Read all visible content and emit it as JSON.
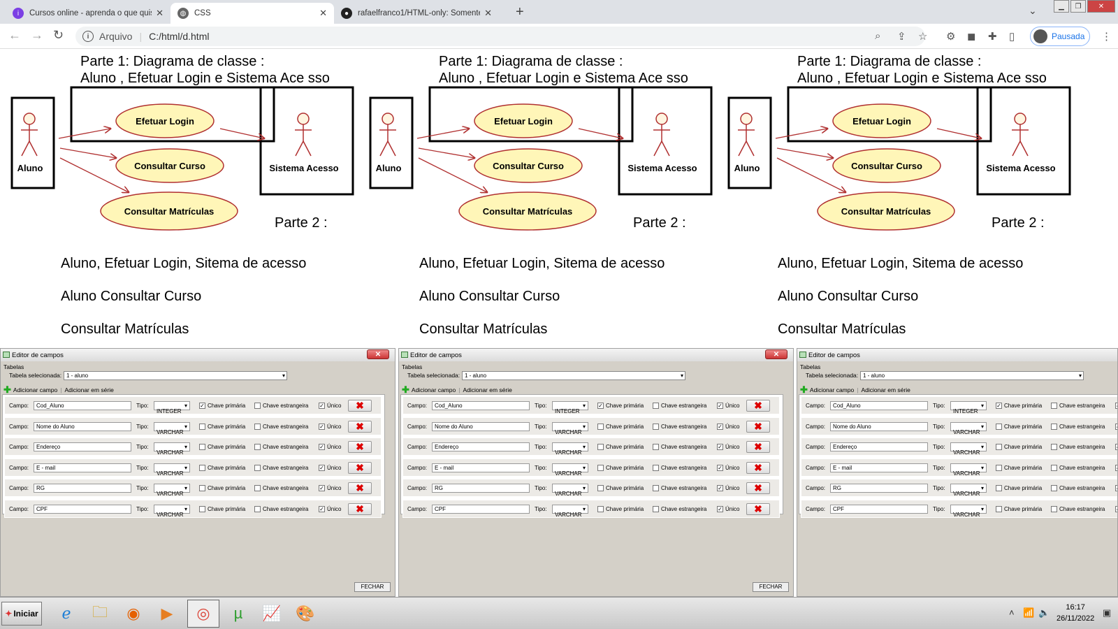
{
  "browser": {
    "tabs": [
      {
        "title": "Cursos online - aprenda o que quiser",
        "icon": "alura-icon",
        "active": false
      },
      {
        "title": "CSS",
        "icon": "globe-icon",
        "active": true
      },
      {
        "title": "rafaelfranco1/HTML-only: Somente",
        "icon": "github-icon",
        "active": false
      }
    ],
    "new_tab": "+",
    "address_prefix": "Arquivo",
    "url": "C:/html/d.html",
    "profile_label": "Pausada"
  },
  "page": {
    "heading_line1": "Parte 1: Diagrama de classe :",
    "heading_line2": "Aluno , Efetuar Login e Sistema Ace sso",
    "actor_left": "Aluno",
    "actor_right": "Sistema Acesso",
    "usecases": [
      "Efetuar Login",
      "Consultar Curso",
      "Consultar Matrículas"
    ],
    "parte2": "Parte 2 :",
    "lines": [
      "Aluno, Efetuar Login, Sitema de acesso",
      "Aluno Consultar Curso",
      "Consultar Matrículas"
    ]
  },
  "dialog": {
    "title": "Editor de campos",
    "section": "Tabelas",
    "table_label": "Tabela selecionada:",
    "table_value": "1 - aluno",
    "add_field": "Adicionar campo",
    "add_series": "Adicionar em série",
    "campo_label": "Campo:",
    "tipo_label": "Tipo:",
    "pk_label": "Chave primária",
    "fk_label": "Chave estrangeira",
    "unique_label": "Único",
    "close_button": "FECHAR",
    "fields": [
      {
        "name": "Cod_Aluno",
        "type": "INTEGER",
        "pk": true,
        "fk": false,
        "unique": true
      },
      {
        "name": "Nome do Aluno",
        "type": "VARCHAR",
        "pk": false,
        "fk": false,
        "unique": true
      },
      {
        "name": "Endereço",
        "type": "VARCHAR",
        "pk": false,
        "fk": false,
        "unique": true
      },
      {
        "name": "E - mail",
        "type": "VARCHAR",
        "pk": false,
        "fk": false,
        "unique": true
      },
      {
        "name": "RG",
        "type": "VARCHAR",
        "pk": false,
        "fk": false,
        "unique": true
      },
      {
        "name": "CPF",
        "type": "VARCHAR",
        "pk": false,
        "fk": false,
        "unique": true
      }
    ]
  },
  "taskbar": {
    "start_label": "Iniciar",
    "apps": [
      "ie-icon",
      "folder-icon",
      "firefox-icon",
      "media-player-icon",
      "chrome-icon",
      "utorrent-icon",
      "chart-app-icon",
      "paint-icon"
    ],
    "time": "16:17",
    "date": "26/11/2022"
  }
}
